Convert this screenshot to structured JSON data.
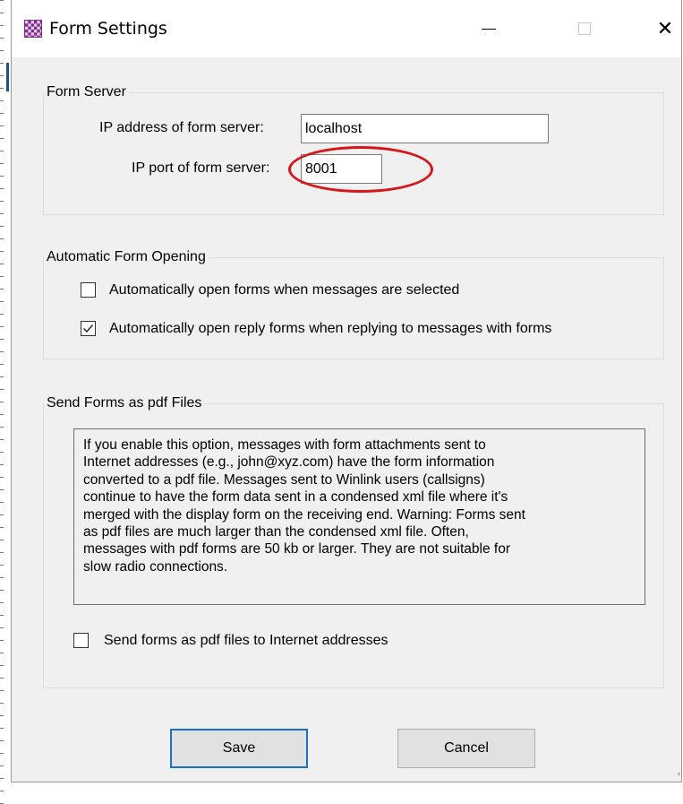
{
  "window": {
    "title": "Form Settings",
    "icon": "checkered-purple-icon",
    "controls": {
      "minimize": "minimize-icon",
      "maximize": "maximize-icon",
      "close": "✕"
    }
  },
  "form_server": {
    "group_label": "Form Server",
    "ip_address_label": "IP address of form server:",
    "ip_address_value": "localhost",
    "ip_port_label": "IP port of form server:",
    "ip_port_value": "8001"
  },
  "auto_open": {
    "group_label": "Automatic Form Opening",
    "options": [
      {
        "label": "Automatically open forms when messages are selected",
        "checked": false
      },
      {
        "label": "Automatically open reply forms when replying to messages with forms",
        "checked": true
      }
    ]
  },
  "pdf": {
    "group_label": "Send Forms as pdf Files",
    "note_lines": [
      "If you enable this option, messages with form attachments sent to",
      "Internet addresses (e.g., john@xyz.com) have the form information",
      "converted to a pdf file.  Messages sent to Winlink users (callsigns)",
      "continue to have the form data sent in a condensed xml file where it's",
      "merged with the display form on the receiving end.  Warning: Forms sent",
      "as pdf files are much larger than the condensed xml file.  Often,",
      "messages with pdf forms are 50 kb or larger. They are not suitable for",
      "slow radio connections."
    ],
    "checkbox_label": "Send forms as pdf files to Internet addresses",
    "checkbox_checked": false
  },
  "buttons": {
    "save": "Save",
    "cancel": "Cancel"
  },
  "colors": {
    "highlight_ellipse": "#d6161b",
    "default_button_border": "#1c6fc6"
  }
}
